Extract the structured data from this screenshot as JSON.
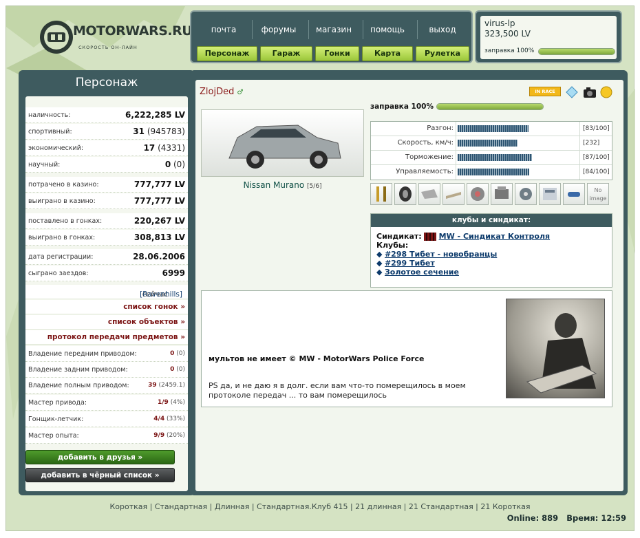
{
  "logo": {
    "name": "MOTORWARS.RU",
    "tagline": "СКОРОСТЬ ОН-ЛАЙН"
  },
  "nav": {
    "links": [
      "почта",
      "форумы",
      "магазин",
      "помощь",
      "выход"
    ],
    "buttons": [
      "Персонаж",
      "Гараж",
      "Гонки",
      "Карта",
      "Рулетка"
    ]
  },
  "user": {
    "name": "virus-lp",
    "money": "323,500 LV",
    "fuel_label": "заправка 100%",
    "fuel_level": 1.0
  },
  "left": {
    "title": "Персонаж",
    "stats": [
      {
        "label": "наличность:",
        "value": "6,222,285 LV",
        "extra": ""
      },
      {
        "label": "спортивный:",
        "value": "31",
        "extra": " (945783)"
      },
      {
        "label": "экономический:",
        "value": "17",
        "extra": " (4331)"
      },
      {
        "label": "научный:",
        "value": "0",
        "extra": " (0)"
      },
      {
        "label": "потрачено в казино:",
        "value": "777,777 LV",
        "extra": ""
      },
      {
        "label": "выиграно в казино:",
        "value": "777,777 LV",
        "extra": ""
      },
      {
        "label": "поставлено в гонках:",
        "value": "220,267 LV",
        "extra": ""
      },
      {
        "label": "выиграно в гонках:",
        "value": "308,813 LV",
        "extra": ""
      },
      {
        "label": "дата регистрации:",
        "value": "28.06.2006",
        "extra": ""
      },
      {
        "label": "сыграно заездов:",
        "value": "6999",
        "extra": ""
      }
    ],
    "location_prefix": "сейчас находится в",
    "location": "[Ravenhills]",
    "links": [
      "список гонок »",
      "список объектов »",
      "протокол передачи предметов »"
    ],
    "drives": [
      {
        "label": "Владение передним приводом:",
        "value": "0",
        "extra": "(0)"
      },
      {
        "label": "Владение задним приводом:",
        "value": "0",
        "extra": "(0)"
      },
      {
        "label": "Владение полным приводом:",
        "value": "39",
        "extra": "(2459.1)"
      }
    ],
    "masters": [
      {
        "label": "Мастер привода:",
        "value": "1/9",
        "extra": "(4%)"
      },
      {
        "label": "Гонщик-летчик:",
        "value": "4/4",
        "extra": "(33%)"
      },
      {
        "label": "Мастер опыта:",
        "value": "9/9",
        "extra": "(20%)"
      }
    ],
    "add_friend": "добавить в друзья »",
    "add_black": "добавить в чёрный список »"
  },
  "profile": {
    "name": "ZlojDed",
    "car_name": "Nissan Murano",
    "car_level": "[5/6]",
    "in_race": "IN RACE",
    "fuel_label": "заправка 100%",
    "fuel_level": 1.0,
    "car_stats": [
      {
        "label": "Разгон:",
        "value": "[83/100]",
        "level": 0.83
      },
      {
        "label": "Скорость, км/ч:",
        "value": "[232]",
        "level": 0.7
      },
      {
        "label": "Торможение:",
        "value": "[87/100]",
        "level": 0.87
      },
      {
        "label": "Управляемость:",
        "value": "[84/100]",
        "level": 0.84
      }
    ],
    "no_image": "No image",
    "clubs_header": "клубы и синдикат:",
    "syndicate_label": "Синдикат:",
    "syndicate": "MW - Синдикат Контроля",
    "clubs_label": "Клубы:",
    "clubs": [
      "#298 Тибет - новобранцы",
      "#299 Тибет",
      "Золотое сечение"
    ],
    "about_line1": "мультов не имеет © MW - MotorWars Police Force",
    "about_line2": "PS да, и не даю я в долг. если вам что-то померещилось в моем протоколе передач ... то вам померещилось"
  },
  "footer": {
    "links": "Короткая | Стандартная | Длинная | Стандартная.Клуб 415 | 21 длинная | 21 Стандартная | 21 Короткая",
    "online": "Online: 889",
    "time": "Время: 12:59"
  },
  "colors": {
    "panel": "#3e5b5f",
    "accent_green": "#9bc63a",
    "dark_red": "#7b1414",
    "link_blue": "#0c3a6b"
  }
}
